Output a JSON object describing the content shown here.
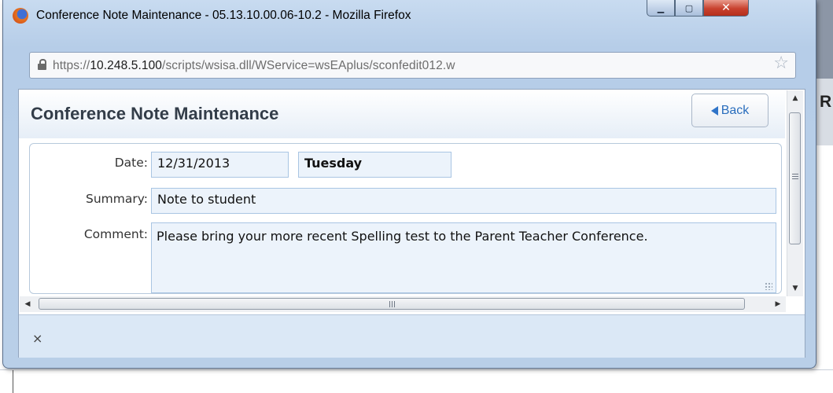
{
  "browser": {
    "window_title": "Conference Note Maintenance - 05.13.10.00.06-10.2 - Mozilla Firefox",
    "url_prefix": "https://",
    "url_host": "10.248.5.100",
    "url_path": "/scripts/wsisa.dll/WService=wsEAplus/sconfedit012.w",
    "icons": [
      "firefox-logo",
      "lock-icon",
      "bookmark-star-icon",
      "minimize-icon",
      "maximize-icon",
      "close-icon"
    ]
  },
  "background_page": {
    "partial_letter": "R"
  },
  "dialog": {
    "title": "Conference Note Maintenance",
    "back_label": "Back",
    "form": {
      "date_label": "Date:",
      "date_value": "12/31/2013",
      "day_value": "Tuesday",
      "summary_label": "Summary:",
      "summary_value": "Note to student",
      "comment_label": "Comment:",
      "comment_value": "Please bring your more recent Spelling test to the Parent Teacher Conference."
    },
    "footer_close": "×"
  },
  "colors": {
    "field_bg": "#ecf3fb",
    "field_border": "#a9c5e3",
    "footer_bg": "#dbe8f6",
    "back_text": "#2a6ebd"
  }
}
